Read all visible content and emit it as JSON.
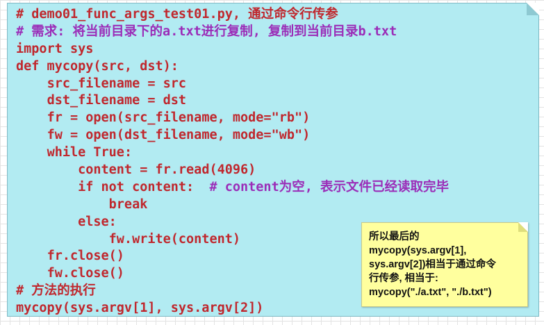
{
  "code": {
    "lines": [
      {
        "indent": "",
        "text": "# demo01_func_args_test01.py, 通过命令行传参",
        "kind": "comment-red"
      },
      {
        "indent": "",
        "text": "# 需求: 将当前目录下的a.txt进行复制, 复制到当前目录b.txt",
        "kind": "comment"
      },
      {
        "indent": "",
        "text": "import sys",
        "kind": "code"
      },
      {
        "indent": "",
        "text": "def mycopy(src, dst):",
        "kind": "code"
      },
      {
        "indent": "    ",
        "text": "src_filename = src",
        "kind": "code"
      },
      {
        "indent": "    ",
        "text": "dst_filename = dst",
        "kind": "code"
      },
      {
        "indent": "    ",
        "text": "fr = open(src_filename, mode=\"rb\")",
        "kind": "code"
      },
      {
        "indent": "    ",
        "text": "fw = open(dst_filename, mode=\"wb\")",
        "kind": "code"
      },
      {
        "indent": "    ",
        "text": "while True:",
        "kind": "code"
      },
      {
        "indent": "        ",
        "text": "content = fr.read(4096)",
        "kind": "code"
      },
      {
        "indent": "        ",
        "text": "if not content:  ",
        "kind": "code",
        "trailing_comment": "# content为空, 表示文件已经读取完毕"
      },
      {
        "indent": "            ",
        "text": "break",
        "kind": "code"
      },
      {
        "indent": "        ",
        "text": "else:",
        "kind": "code"
      },
      {
        "indent": "            ",
        "text": "fw.write(content)",
        "kind": "code"
      },
      {
        "indent": "    ",
        "text": "fr.close()",
        "kind": "code"
      },
      {
        "indent": "    ",
        "text": "fw.close()",
        "kind": "code"
      },
      {
        "indent": "",
        "text": "# 方法的执行",
        "kind": "comment-red"
      },
      {
        "indent": "",
        "text": "mycopy(sys.argv[1], sys.argv[2])",
        "kind": "code"
      }
    ]
  },
  "note": {
    "lines": [
      "所以最后的",
      "mycopy(sys.argv[1],",
      "sys.argv[2])相当于通过命令",
      "行传参, 相当于:",
      "mycopy(\"./a.txt\", \"./b.txt\")"
    ]
  },
  "colors": {
    "panel_background": "#b2ebf2",
    "code_text": "#c0272d",
    "comment_text": "#9b2db8",
    "note_background": "#ffff9e"
  }
}
